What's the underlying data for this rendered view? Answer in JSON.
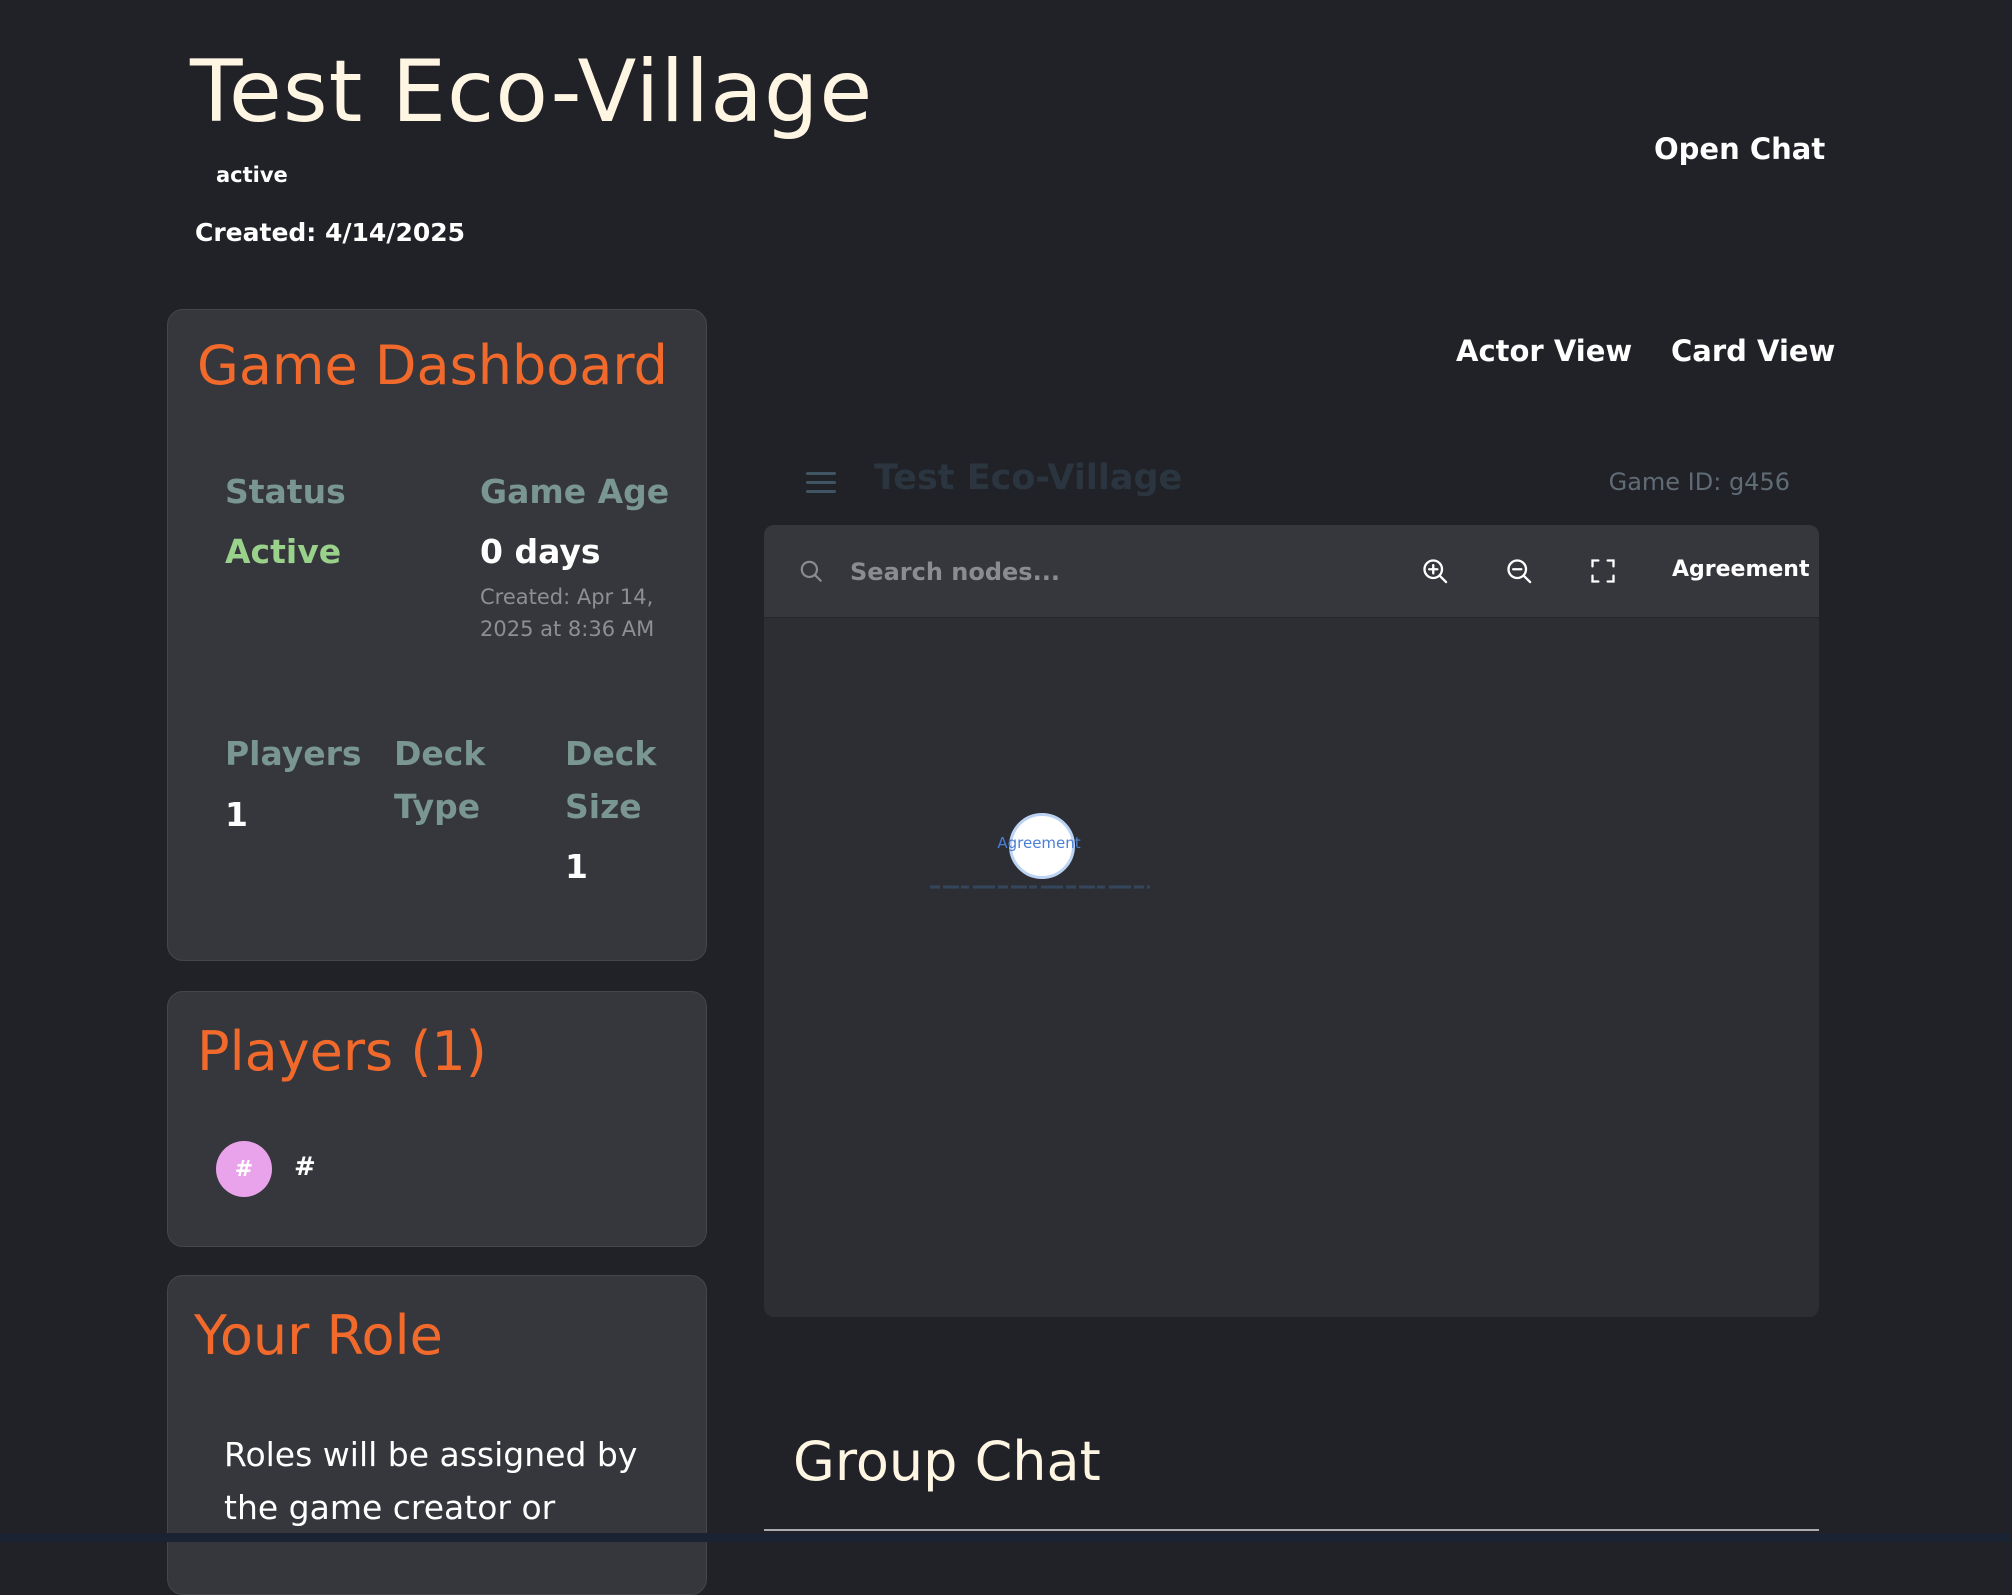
{
  "header": {
    "title": "Test Eco-Village",
    "status": "active",
    "created": "Created: 4/14/2025",
    "open_chat": "Open Chat"
  },
  "dashboard": {
    "title": "Game Dashboard",
    "status_label": "Status",
    "status_value": "Active",
    "age_label": "Game Age",
    "age_value": "0 days",
    "age_created": "Created: Apr 14, 2025 at 8:36 AM",
    "players_label": "Players",
    "players_value": "1",
    "deck_type_label": "Deck Type",
    "deck_type_value": "",
    "deck_size_label": "Deck Size",
    "deck_size_value": "1"
  },
  "players": {
    "title": "Players (1)",
    "list": [
      {
        "initial": "#",
        "name": "#",
        "avatar_color": "#e9a3ea"
      }
    ]
  },
  "role": {
    "title": "Your Role",
    "text": "Roles will be assigned by the game creator or"
  },
  "views": {
    "actor": "Actor View",
    "card": "Card View"
  },
  "graph": {
    "header_title": "Test Eco-Village",
    "game_id": "Game ID: g456",
    "search_placeholder": "Search nodes...",
    "filter_label": "Agreement",
    "node_label": "Agreement"
  },
  "chat": {
    "title": "Group Chat"
  },
  "colors": {
    "background": "#212227",
    "card": "#35373c",
    "accent": "#f26a2b",
    "active_status": "#9ad18b",
    "label": "#7a9690",
    "title_text": "#fff5e3",
    "node_label": "#4a7fd6"
  },
  "icons": [
    "search-icon",
    "zoom-in-icon",
    "zoom-out-icon",
    "fullscreen-icon",
    "menu-icon"
  ]
}
